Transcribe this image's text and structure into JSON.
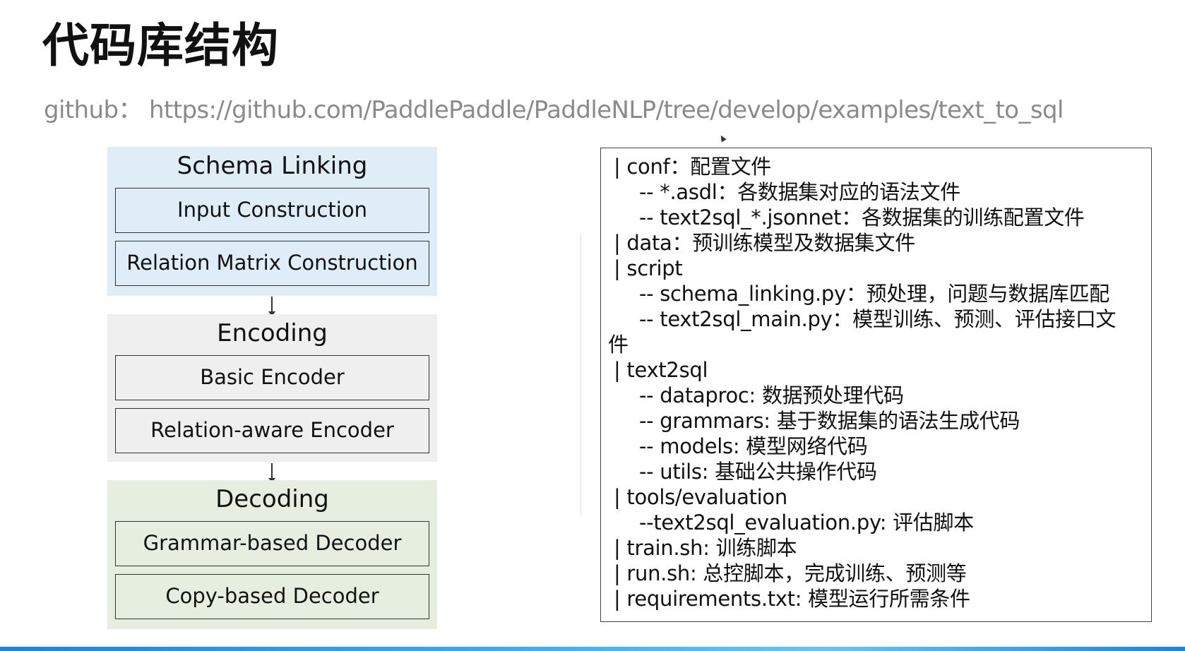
{
  "slide": {
    "title": "代码库结构",
    "github_line": "github： https://github.com/PaddlePaddle/PaddleNLP/tree/develop/examples/text_to_sql"
  },
  "diagram": {
    "sections": [
      {
        "title": "Schema Linking",
        "steps": [
          "Input Construction",
          "Relation Matrix Construction"
        ],
        "color": "#dfedf7"
      },
      {
        "title": "Encoding",
        "steps": [
          "Basic Encoder",
          "Relation-aware Encoder"
        ],
        "color": "#efefef"
      },
      {
        "title": "Decoding",
        "steps": [
          "Grammar-based Decoder",
          "Copy-based Decoder"
        ],
        "color": "#e6efdf"
      }
    ]
  },
  "tree": {
    "lines": [
      "| conf：配置文件",
      "-- *.asdl：各数据集对应的语法文件",
      "-- text2sql_*.jsonnet：各数据集的训练配置文件",
      "| data：预训练模型及数据集文件",
      "| script",
      "-- schema_linking.py：预处理，问题与数据库匹配",
      "-- text2sql_main.py：模型训练、预测、评估接口文",
      "件",
      "| text2sql",
      "-- dataproc: 数据预处理代码",
      "-- grammars: 基于数据集的语法生成代码",
      "-- models: 模型网络代码",
      "-- utils: 基础公共操作代码",
      "| tools/evaluation",
      "--text2sql_evaluation.py: 评估脚本",
      "| train.sh: 训练脚本",
      "| run.sh: 总控脚本，完成训练、预测等",
      "| requirements.txt: 模型运行所需条件"
    ]
  },
  "colors": {
    "schema_panel": "#dfedf7",
    "encoding_panel": "#efefef",
    "decoding_panel": "#e6efdf",
    "link_text": "#8a8a8a",
    "accent_bar": "#1e84d6"
  }
}
